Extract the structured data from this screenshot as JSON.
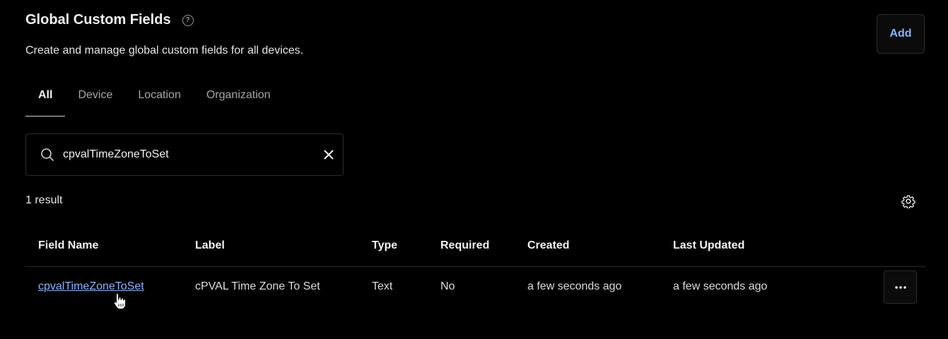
{
  "header": {
    "title": "Global Custom Fields",
    "help_icon": "question-circle-icon",
    "subtitle": "Create and manage global custom fields for all devices.",
    "add_label": "Add"
  },
  "tabs": [
    {
      "label": "All",
      "active": true
    },
    {
      "label": "Device",
      "active": false
    },
    {
      "label": "Location",
      "active": false
    },
    {
      "label": "Organization",
      "active": false
    }
  ],
  "search": {
    "value": "cpvalTimeZoneToSet",
    "icon": "search-icon",
    "clear_icon": "close-icon"
  },
  "results": {
    "count_text": "1 result",
    "settings_icon": "gear-icon"
  },
  "table": {
    "columns": [
      "Field Name",
      "Label",
      "Type",
      "Required",
      "Created",
      "Last Updated"
    ],
    "rows": [
      {
        "field_name": "cpvalTimeZoneToSet",
        "label": "cPVAL Time Zone To Set",
        "type": "Text",
        "required": "No",
        "created": "a few seconds ago",
        "last_updated": "a few seconds ago",
        "actions_icon": "more-horizontal-icon"
      }
    ]
  },
  "colors": {
    "background": "#000000",
    "accent_link": "#8ab4ff",
    "border": "#2c2c2c"
  }
}
